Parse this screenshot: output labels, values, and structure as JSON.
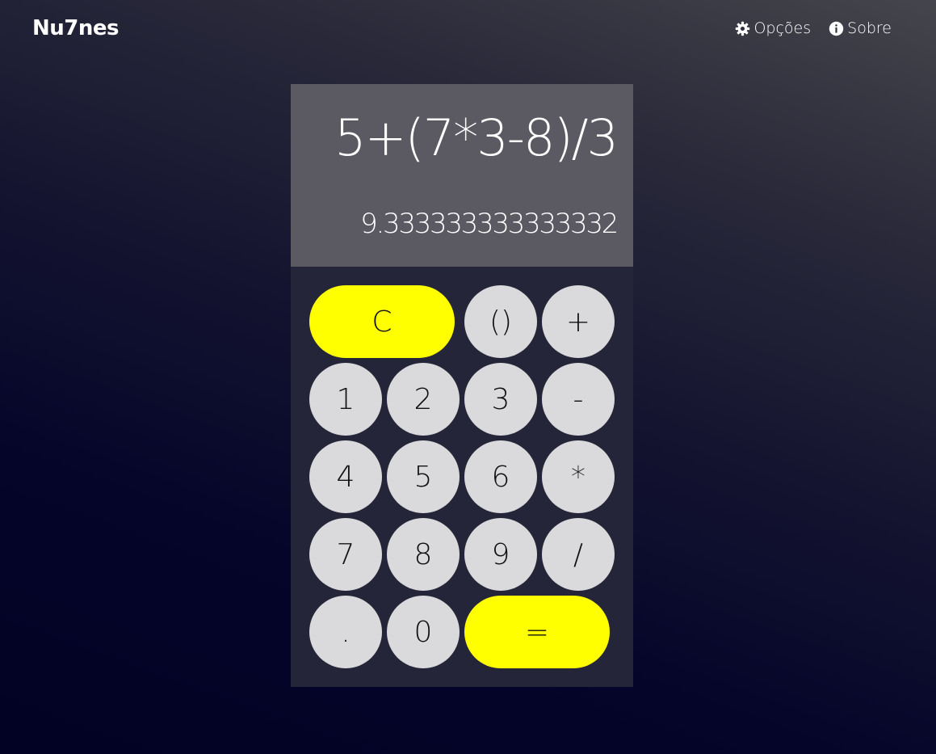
{
  "brand": "Nu7nes",
  "nav": {
    "options_label": "Opções",
    "about_label": "Sobre"
  },
  "display": {
    "expression": "5+(7*3-8)/3",
    "result": "9.333333333333332"
  },
  "keys": {
    "clear": "C",
    "parens": "()",
    "plus": "+",
    "one": "1",
    "two": "2",
    "three": "3",
    "minus": "-",
    "four": "4",
    "five": "5",
    "six": "6",
    "multiply": "*",
    "seven": "7",
    "eight": "8",
    "nine": "9",
    "divide": "/",
    "decimal": ".",
    "zero": "0",
    "equals": "="
  },
  "colors": {
    "accent": "#ffff00",
    "key": "#dadadc",
    "screen": "#5b5a63",
    "keypad_bg": "#252539"
  },
  "icons": {
    "options": "gear-icon",
    "about": "info-icon"
  }
}
